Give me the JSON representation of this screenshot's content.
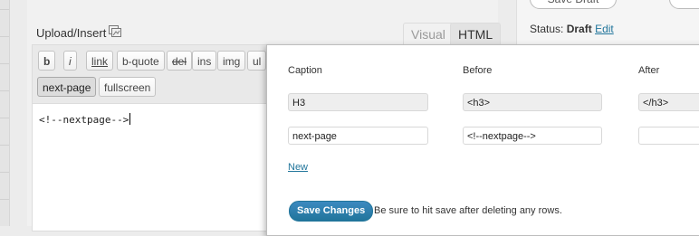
{
  "editor": {
    "upload_insert_label": "Upload/Insert",
    "media_icon": "add-media-icon",
    "tabs": {
      "visual": "Visual",
      "html": "HTML"
    },
    "quicktags": [
      "b",
      "i",
      "link",
      "b-quote",
      "del",
      "ins",
      "img",
      "ul"
    ],
    "quicktags_row2": [
      "next-page",
      "fullscreen"
    ],
    "content": "<!--nextpage-->"
  },
  "publish": {
    "save_draft": "Save Draft",
    "status_label": "Status:",
    "status_value": "Draft",
    "edit_link": "Edit"
  },
  "settings_panel": {
    "headers": {
      "caption": "Caption",
      "before": "Before",
      "after": "After"
    },
    "rows": [
      {
        "caption": "H3",
        "before": "<h3>",
        "after": "</h3>",
        "readonly": true
      },
      {
        "caption": "next-page",
        "before": "<!--nextpage-->",
        "after": "",
        "readonly": false
      }
    ],
    "new_link": "New",
    "save_button": "Save Changes",
    "save_hint": "Be sure to hit save after deleting any rows."
  },
  "colors": {
    "link": "#21759b",
    "primary_button": "#21759b"
  }
}
